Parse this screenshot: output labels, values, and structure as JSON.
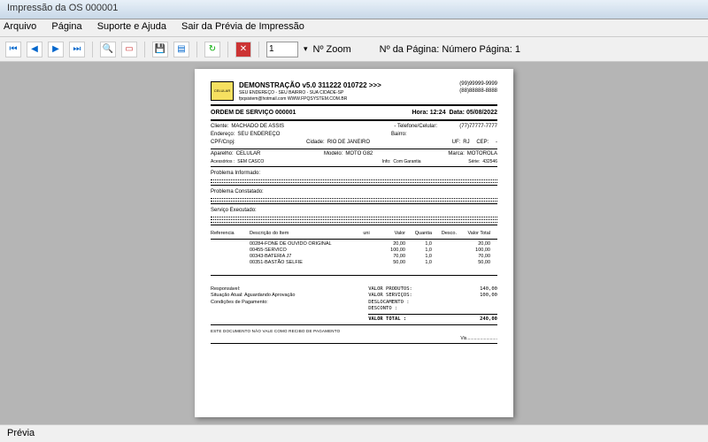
{
  "window": {
    "title": "Impressão da OS 000001"
  },
  "menu": {
    "arquivo": "Arquivo",
    "pagina": "Página",
    "suporte": "Suporte e Ajuda",
    "sair": "Sair da Prévia de Impressão"
  },
  "toolbar": {
    "page_spin": "1",
    "zoom_label": "Nº Zoom",
    "page_label": "Nº da Página: Número Página: 1"
  },
  "statusbar": {
    "text": "Prévia"
  },
  "doc": {
    "header": {
      "logo_text": "CELULAR",
      "title": "DEMONSTRAÇÃO v5.0 311222 010722 >>>",
      "addr": "SEU ENDEREÇO - SEU BAIRRO - SUA CIDADE-SP",
      "email": "fpqsistem@hotmail.com WWW.FPQSYSTEM.COM.BR",
      "phone1": "(99)99999-9999",
      "phone2": "(88)88888-8888"
    },
    "os": {
      "title": "ORDEM DE SERVIÇO 000001",
      "hora_lbl": "Hora:",
      "hora": "12:24",
      "data_lbl": "Data:",
      "data": "05/08/2022"
    },
    "cliente": {
      "cliente_lbl": "Cliente:",
      "cliente": "MACHADO DE ASSIS",
      "tel_lbl": "- Telefone/Celular:",
      "tel": "(77)77777-7777",
      "end_lbl": "Endereço:",
      "end": "SEU ENDEREÇO",
      "bairro_lbl": "Bairro:",
      "cpf_lbl": "CPF/Cnpj:",
      "cidade_lbl": "Cidade:",
      "cidade": "RIO DE JANEIRO",
      "uf_lbl": "UF:",
      "uf": "RJ",
      "cep_lbl": "CEP:",
      "cep": "-"
    },
    "aparelho": {
      "ap_lbl": "Aparelho:",
      "ap": "CELULAR",
      "modelo_lbl": "Modelo:",
      "modelo": "MOTO G82",
      "marca_lbl": "Marca:",
      "marca": "MOTOROLA",
      "acess_lbl": "Acessórios :",
      "acess": "SEM CASCO",
      "info_lbl": "Info:",
      "info": "Com Garantia",
      "serie_lbl": "Série:",
      "serie": "432546"
    },
    "sections": {
      "informado": "Problema Informado:",
      "constatado": "Problema Constatado:",
      "executado": "Serviço Executado:"
    },
    "items_header": {
      "ref": "Referencia",
      "desc": "Descrição do Item",
      "uni": "uni",
      "valor": "Valor",
      "quantia": "Quantia",
      "desco": "Desco.",
      "total": "Valor Total"
    },
    "items": [
      {
        "ref": "00284",
        "desc": "FONE DE OUVIDO ORIGINAL",
        "val": "20,00",
        "qty": "1,0",
        "tot": "20,00"
      },
      {
        "ref": "00455",
        "desc": "SERVICO",
        "val": "100,00",
        "qty": "1,0",
        "tot": "100,00"
      },
      {
        "ref": "00343",
        "desc": "BATERIA J7",
        "val": "70,00",
        "qty": "1,0",
        "tot": "70,00"
      },
      {
        "ref": "00351",
        "desc": "BASTÃO SELFIE",
        "val": "50,00",
        "qty": "1,0",
        "tot": "50,00"
      }
    ],
    "footer": {
      "resp_lbl": "Responsável:",
      "sit_lbl": "Situação Atual:",
      "sit": "Aguardando Aprovação",
      "cond_lbl": "Condições de Pagamento:",
      "t_prod_lbl": "VALOR PRODUTOS:",
      "t_prod": "140,00",
      "t_serv_lbl": "VALOR SERVIÇOS:",
      "t_serv": "100,00",
      "t_desloc_lbl": "DESLOCAMENTO :",
      "t_desc_lbl": "DESCONTO     :",
      "t_total_lbl": "VALOR TOTAL  :",
      "t_total": "240,00",
      "note": "ESTE DOCUMENTO NÃO VALE COMO RECIBO DE PAGAMENTO",
      "vis": "Vis........................."
    }
  }
}
